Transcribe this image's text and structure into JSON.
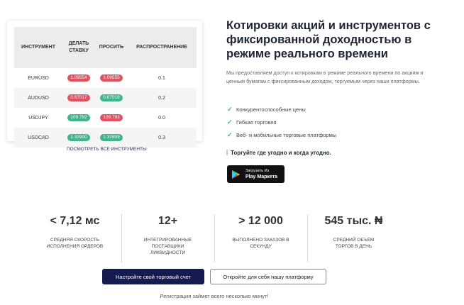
{
  "quotes": {
    "headers": [
      "ИНСТРУМЕНТ",
      "ДЕЛАТЬ\nСТАВКУ",
      "ПРОСИТЬ",
      "РАСПРОСТРАНЕНИЕ"
    ],
    "rows": [
      {
        "instrument": "EURUSD",
        "bid": "1.09554",
        "ask": "1.09555",
        "spread": "0.1",
        "bid_color": "red",
        "ask_color": "red"
      },
      {
        "instrument": "AUDUSD",
        "bid": "0.67017",
        "ask": "0.67019",
        "spread": "0.2",
        "bid_color": "red",
        "ask_color": "green"
      },
      {
        "instrument": "USDJPY",
        "bid": "109.792",
        "ask": "109.793",
        "spread": "0.0",
        "bid_color": "green",
        "ask_color": "red"
      },
      {
        "instrument": "USDCAD",
        "bid": "1.32900",
        "ask": "1.32909",
        "spread": "0.3",
        "bid_color": "green",
        "ask_color": "green"
      }
    ],
    "all_link": "ПОСМОТРЕТЬ ВСЕ ИНСТРУМЕНТЫ"
  },
  "info": {
    "title": "Котировки акций и инструментов с фиксированной доходностью в режиме реального времени",
    "description": "Мы предоставляем доступ к котировкам в режиме реального времени по акциям и ценным бумагам с фиксированным доходом, торгуемым через наши платформы.",
    "features": [
      "Конкурентоспособные цены",
      "Гибкая торговля",
      "Веб- и мобильные торговые платформы"
    ],
    "trade_text": "Торгуйте где угодно и когда угодно.",
    "google_play": {
      "small": "Загрузить Из",
      "big": "Play Маркета"
    }
  },
  "stats": [
    {
      "value": "< 7,12 мс",
      "label": "СРЕДНЯЯ СКОРОСТЬ ИСПОЛНЕНИЯ ОРДЕРОВ"
    },
    {
      "value": "12+",
      "label": "ИНТЕГРИРОВАННЫЕ ПОСТАВЩИКИ ЛИКВИДНОСТИ"
    },
    {
      "value": "> 12 000",
      "label": "ВЫПОЛНЕНО ЗАКАЗОВ В СЕКУНДУ"
    },
    {
      "value": "545 тыс. ₦",
      "label": "СРЕДНИЙ ОБЪЕМ ТОРГОВ В ДЕНЬ"
    }
  ],
  "cta": {
    "primary": "Настройте свой торговый счет",
    "secondary": "Откройте для себя нашу платформу",
    "note": "Регистрация займет всего несколько минут!"
  },
  "colors": {
    "accent": "#151a4f",
    "red": "#e05260",
    "green": "#3fb58a"
  }
}
